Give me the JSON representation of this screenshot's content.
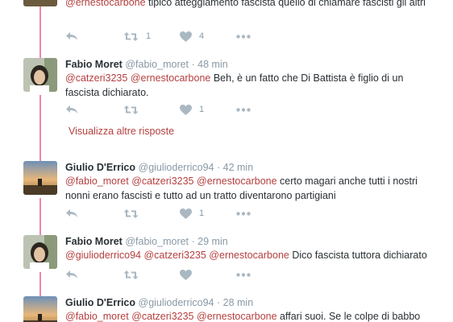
{
  "tweets": [
    {
      "id": "t0",
      "text_segments": [
        {
          "t": "@ernestocarbone",
          "mention": true
        },
        {
          "t": " tipico atteggiamento fascista quello di chiamare fascisti gli altri",
          "mention": false
        }
      ],
      "retweets": "1",
      "likes": "4"
    },
    {
      "id": "t1",
      "fullname": "Fabio Moret",
      "username": "@fabio_moret",
      "sep": "·",
      "time": "48 min",
      "text_segments": [
        {
          "t": "@catzeri3235",
          "mention": true
        },
        {
          "t": " ",
          "mention": false
        },
        {
          "t": "@ernestocarbone",
          "mention": true
        },
        {
          "t": " Beh, è un fatto che Di Battista è figlio di un fascista dichiarato.",
          "mention": false
        }
      ],
      "retweets": "",
      "likes": "1"
    },
    {
      "id": "t2",
      "fullname": "Giulio D'Errico",
      "username": "@giulioderrico94",
      "sep": "·",
      "time": "42 min",
      "text_segments": [
        {
          "t": "@fabio_moret",
          "mention": true
        },
        {
          "t": " ",
          "mention": false
        },
        {
          "t": "@catzeri3235",
          "mention": true
        },
        {
          "t": " ",
          "mention": false
        },
        {
          "t": "@ernestocarbone",
          "mention": true
        },
        {
          "t": " certo magari anche tutti i nostri nonni erano fascisti e tutto ad un tratto diventarono partigiani",
          "mention": false
        }
      ],
      "retweets": "",
      "likes": "1"
    },
    {
      "id": "t3",
      "fullname": "Fabio Moret",
      "username": "@fabio_moret",
      "sep": "·",
      "time": "29 min",
      "text_segments": [
        {
          "t": "@giulioderrico94",
          "mention": true
        },
        {
          "t": " ",
          "mention": false
        },
        {
          "t": "@catzeri3235",
          "mention": true
        },
        {
          "t": " ",
          "mention": false
        },
        {
          "t": "@ernestocarbone",
          "mention": true
        },
        {
          "t": " Dico fascista tuttora dichiarato",
          "mention": false
        }
      ],
      "retweets": "",
      "likes": ""
    },
    {
      "id": "t4",
      "fullname": "Giulio D'Errico",
      "username": "@giulioderrico94",
      "sep": "·",
      "time": "28 min",
      "text_segments": [
        {
          "t": "@fabio_moret",
          "mention": true
        },
        {
          "t": " ",
          "mention": false
        },
        {
          "t": "@catzeri3235",
          "mention": true
        },
        {
          "t": " ",
          "mention": false
        },
        {
          "t": "@ernestocarbone",
          "mention": true
        },
        {
          "t": " affari suoi. Se le colpe di babbo",
          "mention": false
        }
      ]
    }
  ],
  "more_replies_label": "Visualizza altre risposte",
  "icons": {
    "reply": "reply-icon",
    "retweet": "retweet-icon",
    "like": "heart-icon",
    "more": "more-dots-icon"
  },
  "colors": {
    "mention": "#b53f3f",
    "thread_line": "#e0245e",
    "icon": "#aab8c2",
    "meta": "#8899a6"
  }
}
